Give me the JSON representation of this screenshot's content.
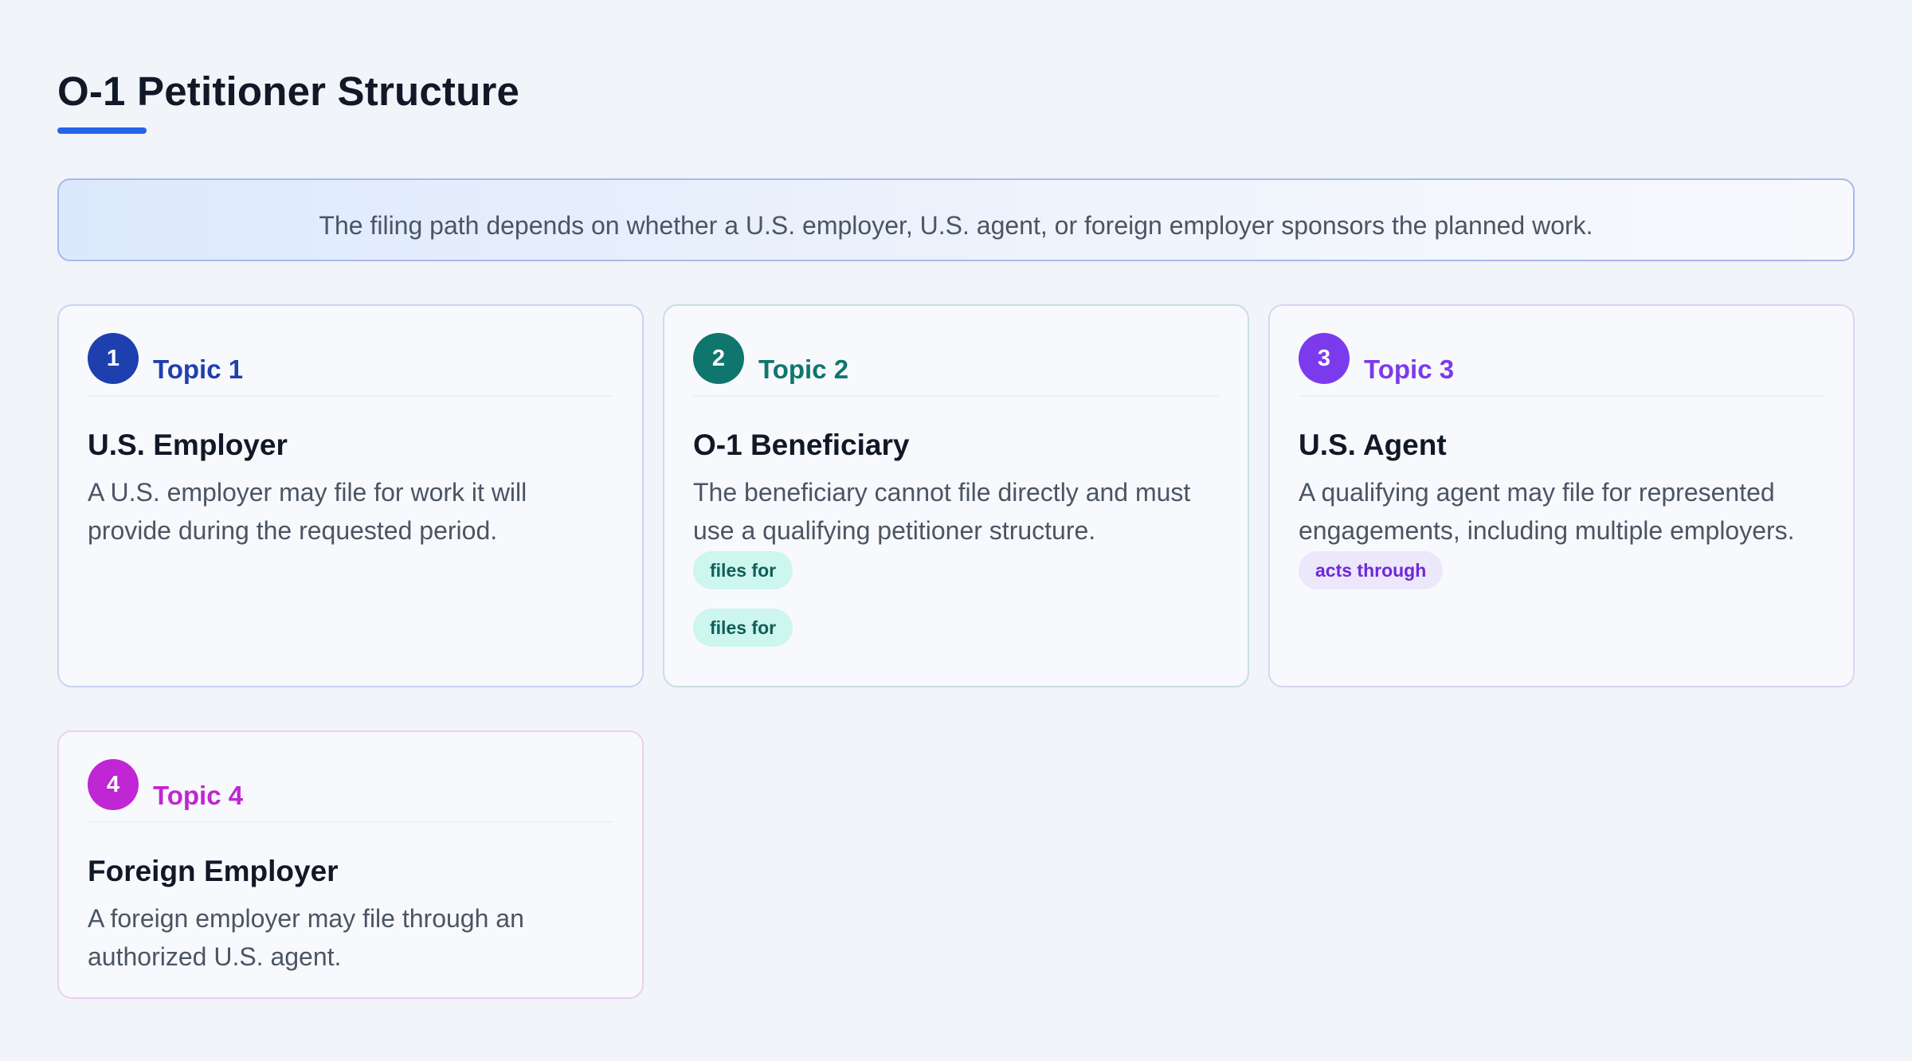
{
  "page": {
    "title": "O-1 Petitioner Structure",
    "intro": "The filing path depends on whether a U.S. employer, U.S. agent, or foreign employer sponsors the planned work."
  },
  "cards": [
    {
      "number": "1",
      "topic": "Topic 1",
      "title": "U.S. Employer",
      "description": "A U.S. employer may file for work it will provide during the requested period.",
      "color": "#1e40af"
    },
    {
      "number": "2",
      "topic": "Topic 2",
      "title": "O-1 Beneficiary",
      "description": "The beneficiary cannot file directly and must use a qualifying petitioner structure.",
      "color": "#0f766e",
      "chips": [
        "files for",
        "files for"
      ]
    },
    {
      "number": "3",
      "topic": "Topic 3",
      "title": "U.S. Agent",
      "description": "A qualifying agent may file for represented engagements, including multiple employers.",
      "color": "#7c3aed",
      "chips": [
        "acts through"
      ]
    },
    {
      "number": "4",
      "topic": "Topic 4",
      "title": "Foreign Employer",
      "description": "A foreign employer may file through an authorized U.S. agent.",
      "color": "#c026d3"
    }
  ]
}
